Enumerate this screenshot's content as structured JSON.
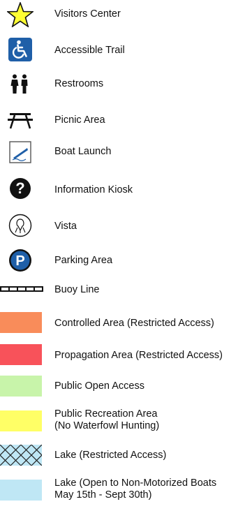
{
  "legend": {
    "items": [
      {
        "label": "Visitors Center",
        "icon": "star-icon"
      },
      {
        "label": "Accessible Trail",
        "icon": "wheelchair-icon"
      },
      {
        "label": "Restrooms",
        "icon": "restroom-icon"
      },
      {
        "label": "Picnic Area",
        "icon": "picnic-table-icon"
      },
      {
        "label": "Boat Launch",
        "icon": "boat-launch-icon"
      },
      {
        "label": "Information Kiosk",
        "icon": "question-mark-icon"
      },
      {
        "label": "Vista",
        "icon": "vista-icon"
      },
      {
        "label": "Parking Area",
        "icon": "parking-icon",
        "glyph": "P"
      },
      {
        "label": "Buoy Line",
        "icon": "buoy-line-icon"
      },
      {
        "label": "Controlled Area (Restricted Access)",
        "color": "#f98c5a"
      },
      {
        "label": "Propagation Area (Restricted Access)",
        "color": "#f8525a"
      },
      {
        "label": "Public Open Access",
        "color": "#c8f4aa"
      },
      {
        "label_line1": "Public Recreation Area",
        "label_line2": "(No Waterfowl Hunting)",
        "color": "#ffff66"
      },
      {
        "label": "Lake (Restricted Access)",
        "color": "#bfe7f5",
        "pattern": "crosshatch"
      },
      {
        "label_line1": "Lake (Open to Non-Motorized Boats",
        "label_line2": "May 15th - Sept 30th)",
        "color": "#bfe7f5"
      }
    ]
  },
  "colors": {
    "star_fill": "#ffff33",
    "accessible_bg": "#1f5fa8",
    "parking_bg": "#1f5fa8",
    "icon_black": "#111111"
  }
}
